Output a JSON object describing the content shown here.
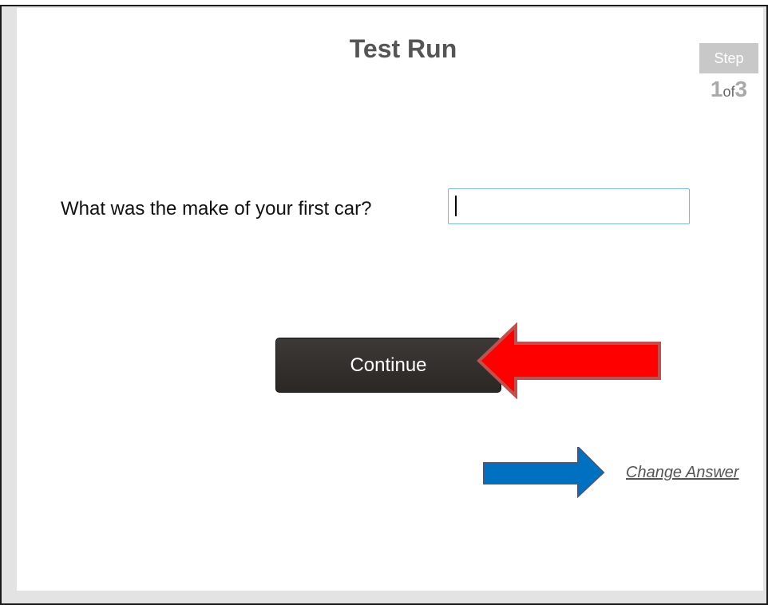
{
  "header": {
    "title": "Test Run"
  },
  "step_indicator": {
    "label": "Step",
    "current": "1",
    "of_text": "of",
    "total": "3"
  },
  "form": {
    "question": "What was the make of your first car?",
    "answer_value": ""
  },
  "actions": {
    "continue_label": "Continue",
    "change_answer_label": "Change Answer"
  },
  "annotations": {
    "red_arrow_color": "#ff0000",
    "blue_arrow_color": "#0070c0"
  }
}
